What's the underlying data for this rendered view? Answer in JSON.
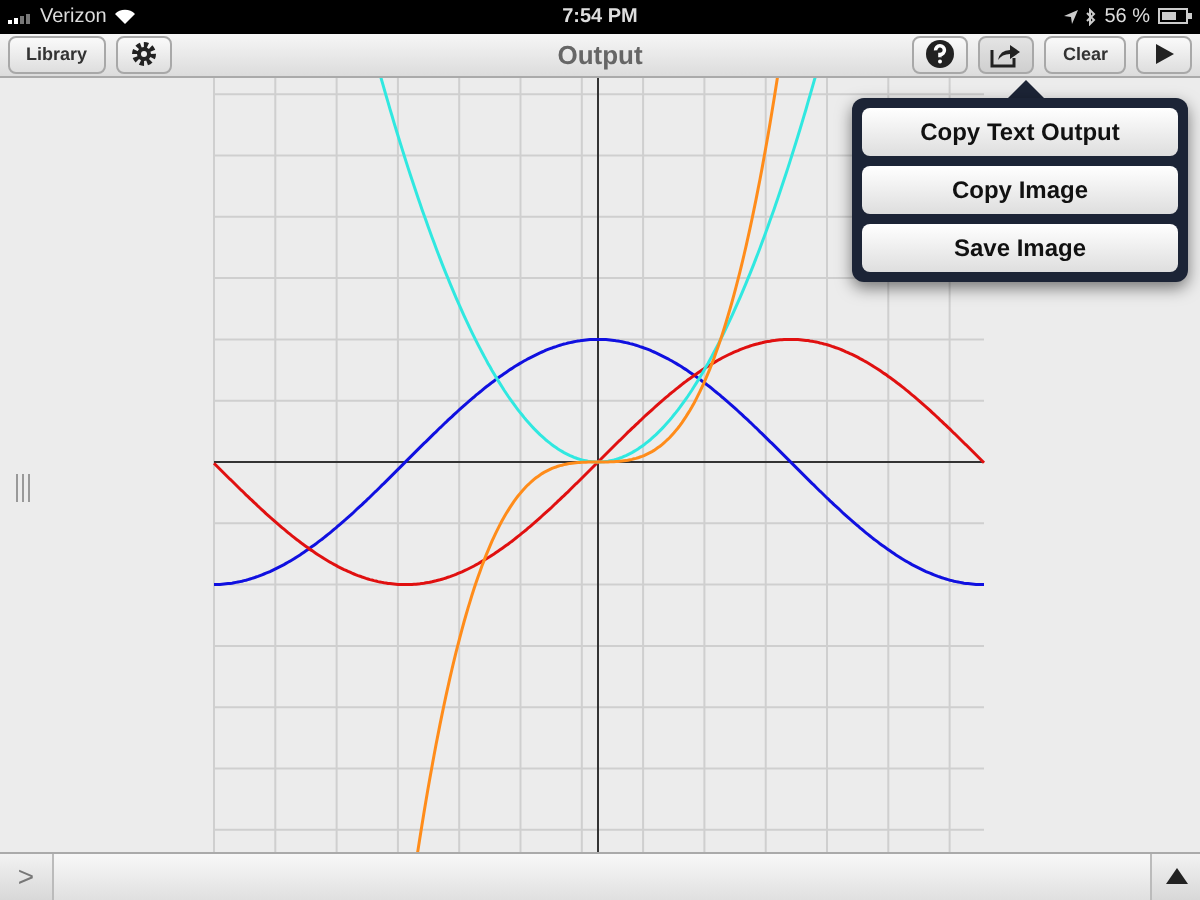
{
  "status_bar": {
    "carrier": "Verizon",
    "time": "7:54 PM",
    "battery": "56 %"
  },
  "toolbar": {
    "library_button": "Library",
    "title": "Output",
    "clear_button": "Clear"
  },
  "popover": {
    "items": [
      "Copy Text Output",
      "Copy Image",
      "Save Image"
    ]
  },
  "bottom_bar": {
    "prompt": ">"
  }
}
